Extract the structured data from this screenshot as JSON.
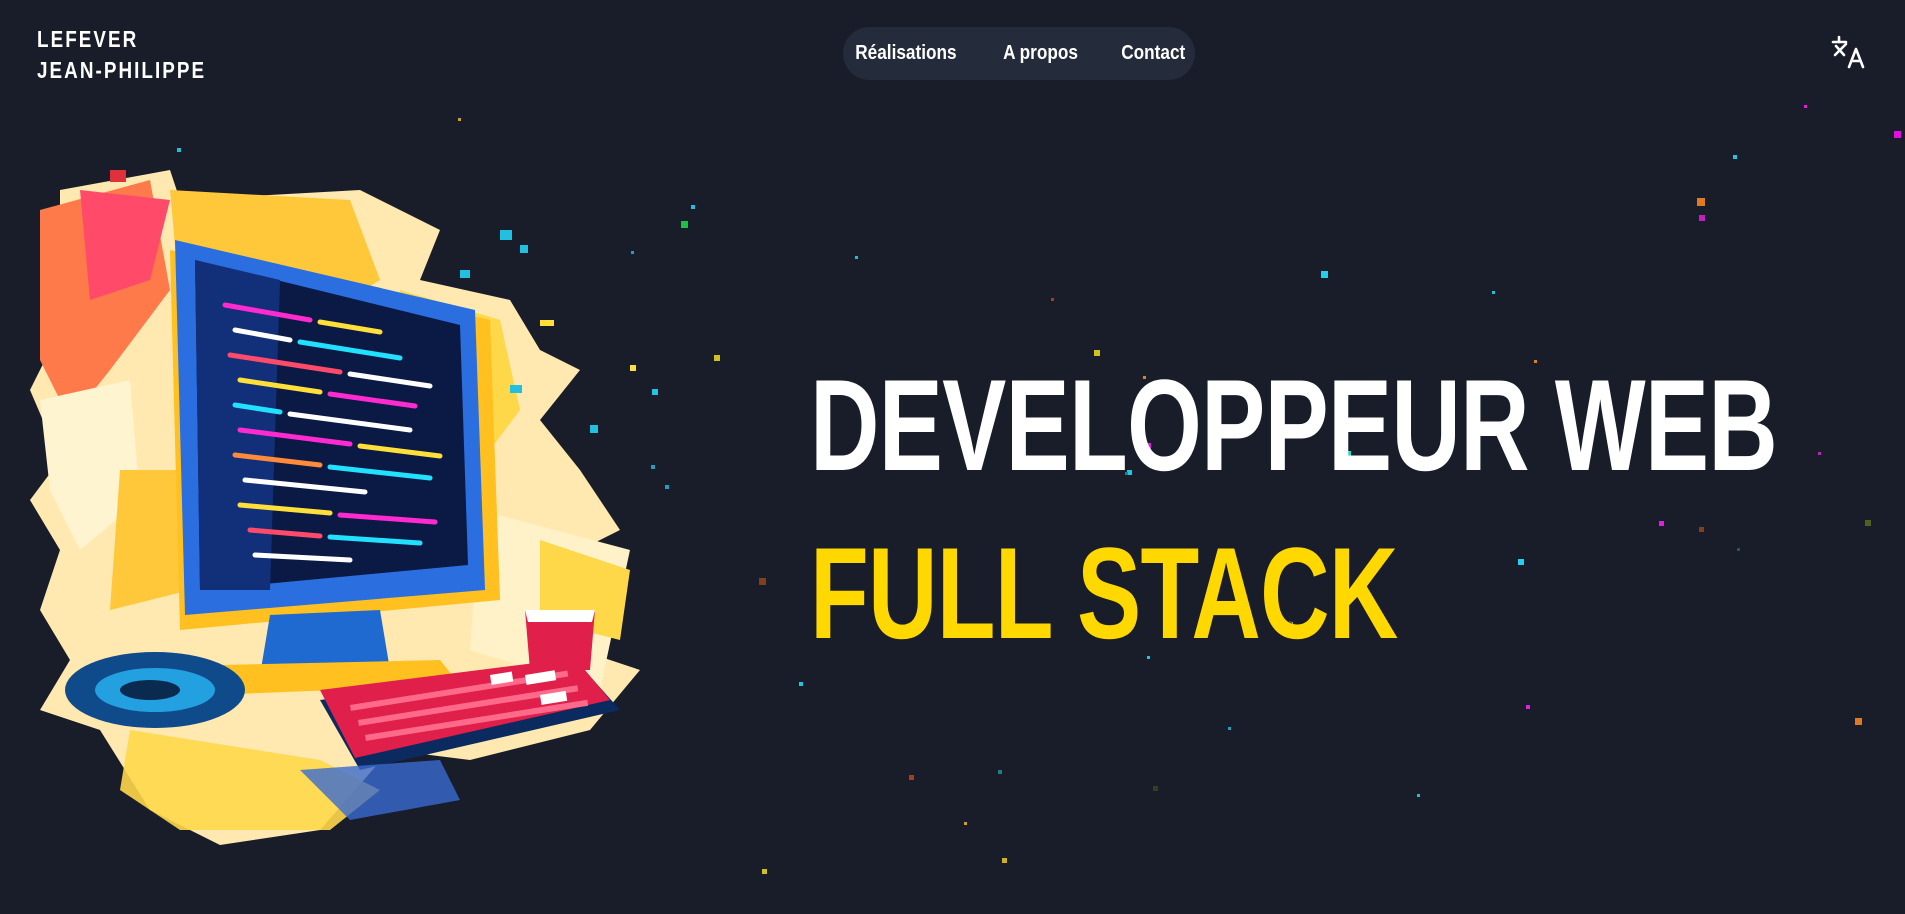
{
  "brand": {
    "line1": "LEFEVER",
    "line2": "JEAN-PHILIPPE"
  },
  "nav": {
    "items": [
      {
        "label": "Réalisations"
      },
      {
        "label": "A propos"
      },
      {
        "label": "Contact"
      }
    ]
  },
  "language_toggle": {
    "icon": "translate-icon"
  },
  "hero": {
    "title_line1": "DEVELOPPEUR WEB",
    "title_line2": "FULL STACK",
    "illustration": "computer-illustration"
  },
  "colors": {
    "background": "#181d29",
    "nav_background": "#242b3b",
    "accent": "#ffd800",
    "text": "#ffffff"
  }
}
